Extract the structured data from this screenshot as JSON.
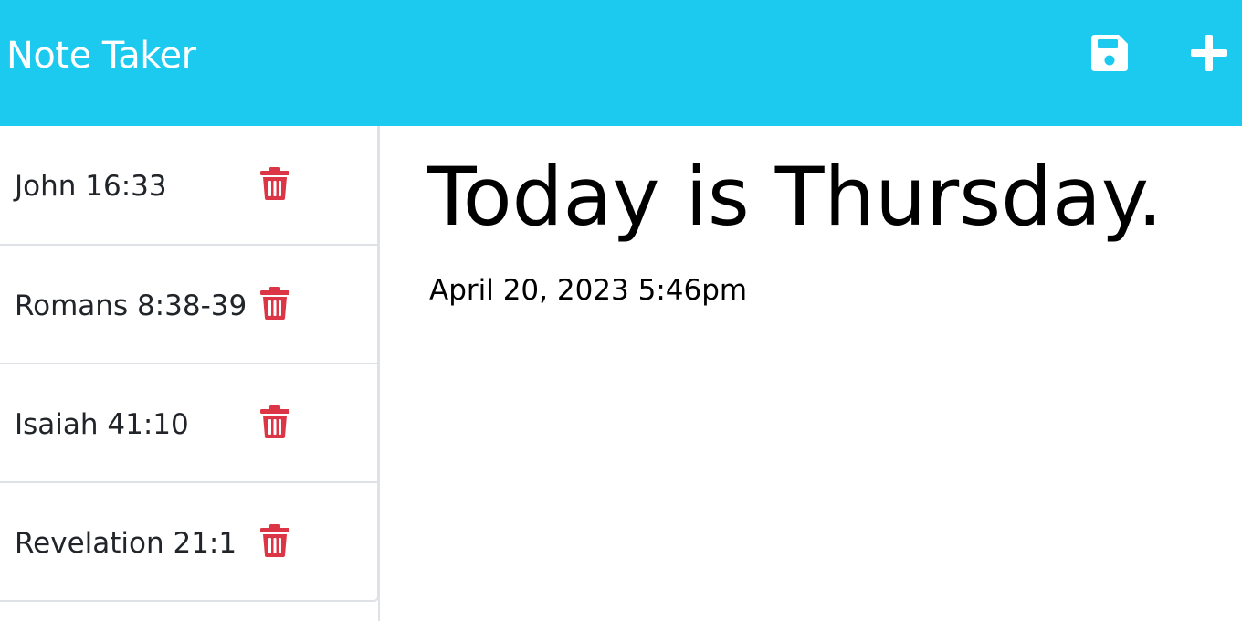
{
  "app": {
    "title": "Note Taker",
    "accent_color": "#1bcaee",
    "delete_color": "#dc3545"
  },
  "toolbar": {
    "save_icon": "save-icon",
    "new_icon": "plus-icon"
  },
  "notes": [
    {
      "title": "John 16:33"
    },
    {
      "title": "Romans 8:38-39"
    },
    {
      "title": "Isaiah 41:10"
    },
    {
      "title": "Revelation 21:1"
    }
  ],
  "active_note": {
    "title": "Today is Thursday.",
    "text": "April 20, 2023 5:46pm"
  }
}
